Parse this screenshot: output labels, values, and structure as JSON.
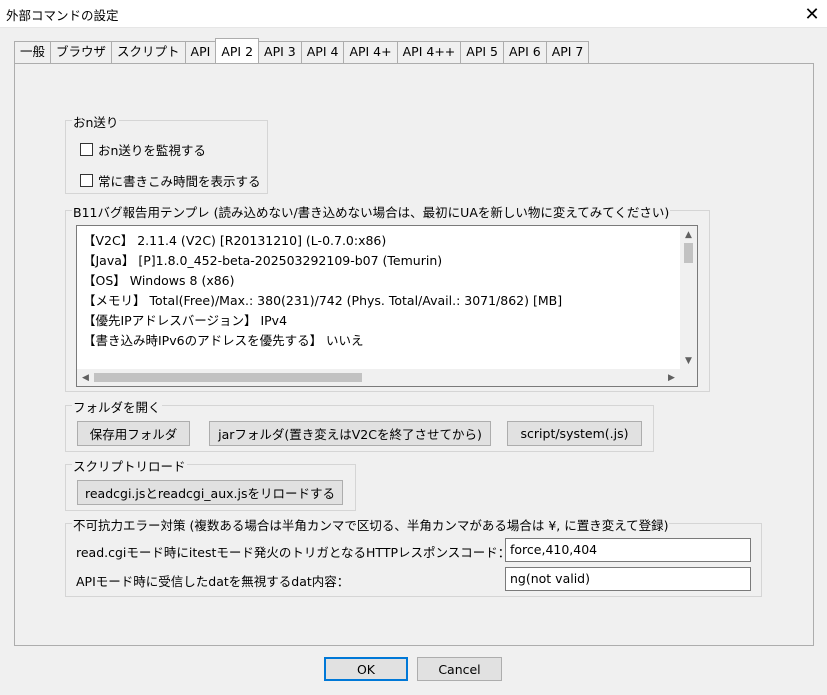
{
  "window": {
    "title": "外部コマンドの設定",
    "close_glyph": "✕"
  },
  "tabs": [
    {
      "label": "一般"
    },
    {
      "label": "ブラウザ"
    },
    {
      "label": "スクリプト"
    },
    {
      "label": "API"
    },
    {
      "label": "API 2",
      "active": true
    },
    {
      "label": "API 3"
    },
    {
      "label": "API 4"
    },
    {
      "label": "API 4+"
    },
    {
      "label": "API 4++"
    },
    {
      "label": "API 5"
    },
    {
      "label": "API 6"
    },
    {
      "label": "API 7"
    }
  ],
  "onsend": {
    "group_label": "おn送り",
    "monitor_label": "おn送りを監視する",
    "monitor_checked": false,
    "always_show_label": "常に書きこみ時間を表示する",
    "always_show_checked": false
  },
  "bug_report": {
    "group_label": "B11バグ報告用テンプレ (読み込めない/書き込めない場合は、最初にUAを新しい物に変えてみてください)",
    "lines": [
      "【V2C】 2.11.4 (V2C) [R20131210] (L-0.7.0:x86)",
      "【Java】 [P]1.8.0_452-beta-202503292109-b07 (Temurin)",
      "【OS】 Windows 8  (x86)",
      "【メモリ】 Total(Free)/Max.: 380(231)/742   (Phys. Total/Avail.: 3071/862)   [MB]",
      "【優先IPアドレスバージョン】 IPv4",
      "【書き込み時IPv6のアドレスを優先する】 いいえ"
    ]
  },
  "folders": {
    "group_label": "フォルダを開く",
    "save_folder": "保存用フォルダ",
    "jar_folder": "jarフォルダ(置き変えはV2Cを終了させてから)",
    "script_system": "script/system(.js)"
  },
  "script_reload": {
    "group_label": "スクリプトリロード",
    "reload_button": "readcgi.jsとreadcgi_aux.jsをリロードする"
  },
  "force_error": {
    "group_label": "不可抗力エラー対策 (複数ある場合は半角カンマで区切る、半角カンマがある場合は ¥, に置き変えて登録)",
    "readcgi_label": "read.cgiモード時にitestモード発火のトリガとなるHTTPレスポンスコード：",
    "readcgi_value": "force,410,404",
    "api_label": "APIモード時に受信したdatを無視するdat内容：",
    "api_value": "ng(not valid)"
  },
  "footer": {
    "ok": "OK",
    "cancel": "Cancel"
  },
  "colors": {
    "background": "#f0f0f0",
    "default_button_border": "#0078d7"
  }
}
